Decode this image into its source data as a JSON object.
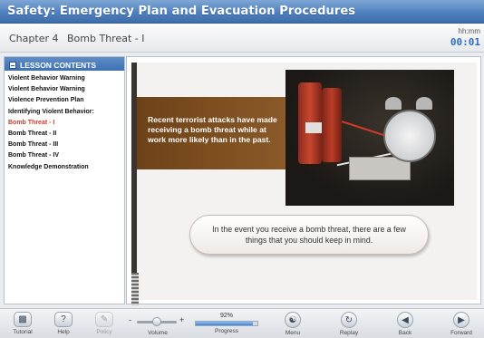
{
  "window": {
    "title": "Safety: Emergency Plan and Evacuation Procedures"
  },
  "chapter": {
    "label": "Chapter 4",
    "lesson": "Bomb Threat - I",
    "timer_label": "hh:mm",
    "timer_value": "00:01"
  },
  "sidebar": {
    "header": "LESSON CONTENTS",
    "items": [
      {
        "label": "Violent Behavior Warning",
        "active": false
      },
      {
        "label": "Violent Behavior Warning",
        "active": false
      },
      {
        "label": "Violence Prevention Plan",
        "active": false
      },
      {
        "label": "Identifying Violent Behavior:",
        "active": false
      },
      {
        "label": "Bomb Threat - I",
        "active": true
      },
      {
        "label": "Bomb Threat - II",
        "active": false
      },
      {
        "label": "Bomb Threat - III",
        "active": false
      },
      {
        "label": "Bomb Threat - IV",
        "active": false
      },
      {
        "label": "Knowledge Demonstration",
        "active": false
      }
    ]
  },
  "slide": {
    "band_text": "Recent terrorist attacks have made receiving a bomb threat while at work more likely than in the past.",
    "callout_text": "In the event you receive a bomb threat, there are a few things that you should keep in mind."
  },
  "toolbar": {
    "tutorial": "Tutorial",
    "help": "Help",
    "policy": "Policy",
    "volume": "Volume",
    "volume_minus": "-",
    "volume_plus": "+",
    "progress_label": "Progress",
    "progress_text": "92%",
    "progress_value": 0.92,
    "menu": "Menu",
    "replay": "Replay",
    "back": "Back",
    "forward": "Forward"
  },
  "icons": {
    "tutorial": "tutorial-icon",
    "help": "help-icon",
    "policy": "policy-icon",
    "menu": "menu-icon",
    "replay": "replay-icon",
    "back": "back-arrow-icon",
    "forward": "forward-arrow-icon"
  },
  "colors": {
    "title_bar": "#4f80bd",
    "active_item": "#d43a2c",
    "timer": "#2f6fbf",
    "band": "#7a4b20"
  }
}
